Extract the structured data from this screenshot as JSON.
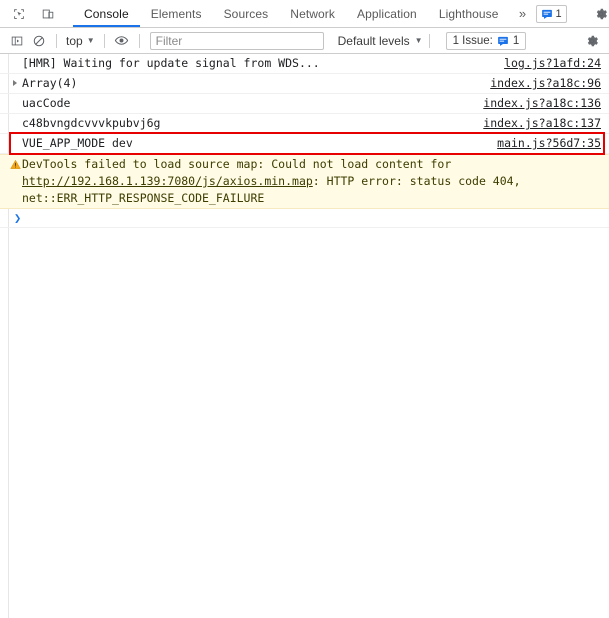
{
  "toolbar": {
    "inspect_icon": "inspect-element-icon",
    "device_icon": "device-toolbar-icon",
    "tabs": [
      {
        "label": "Console",
        "active": true
      },
      {
        "label": "Elements",
        "active": false
      },
      {
        "label": "Sources",
        "active": false
      },
      {
        "label": "Network",
        "active": false
      },
      {
        "label": "Application",
        "active": false
      },
      {
        "label": "Lighthouse",
        "active": false
      }
    ],
    "more_tabs_label": "»",
    "issue_count": "1",
    "settings_icon": "gear-icon",
    "more_icon": "kebab-menu-icon",
    "close_icon": "close-icon"
  },
  "filterbar": {
    "sidebar_icon": "console-sidebar-icon",
    "clear_icon": "clear-console-icon",
    "context": "top",
    "eye_icon": "live-expression-eye-icon",
    "filter_placeholder": "Filter",
    "filter_value": "",
    "levels_label": "Default levels",
    "issues_label": "1 Issue:",
    "issues_count": "1",
    "settings_icon": "console-settings-gear-icon"
  },
  "console": {
    "messages": [
      {
        "text": "[HMR] Waiting for update signal from WDS...",
        "source": "log.js?1afd:24",
        "type": "log",
        "expandable": false
      },
      {
        "text": "Array(4)",
        "source": "index.js?a18c:96",
        "type": "log",
        "expandable": true
      },
      {
        "text": "uacCode",
        "source": "index.js?a18c:136",
        "type": "log",
        "expandable": false
      },
      {
        "text": "c48bvngdcvvvkpubvj6g",
        "source": "index.js?a18c:137",
        "type": "log",
        "expandable": false
      },
      {
        "text": "VUE_APP_MODE dev",
        "source": "main.js?56d7:35",
        "type": "log",
        "expandable": false,
        "highlighted": true
      }
    ],
    "warning": {
      "prefix": "DevTools failed to load source map: Could not load content for ",
      "link": "http://192.168.1.139:7080/js/axios.min.map",
      "suffix": ": HTTP error: status code 404, net::ERR_HTTP_RESPONSE_CODE_FAILURE",
      "icon": "warning-triangle-icon"
    },
    "prompt_symbol": "❯"
  },
  "colors": {
    "accent": "#1a73e8",
    "highlight_border": "#e60000",
    "warning_bg": "#fffbe5",
    "warning_icon": "#f2a61b"
  }
}
